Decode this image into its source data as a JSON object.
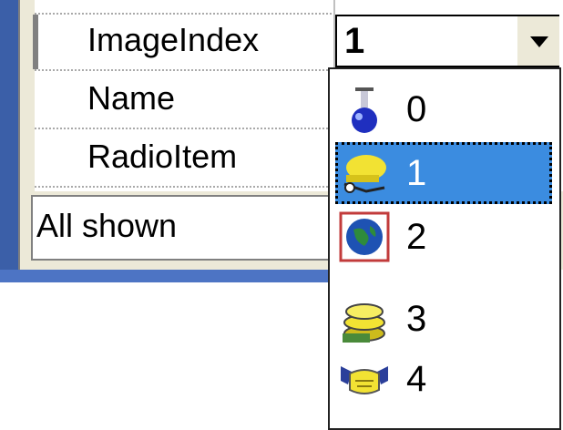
{
  "grid": {
    "rows": [
      {
        "name": "ImageIndex"
      },
      {
        "name": "Name"
      },
      {
        "name": "RadioItem"
      }
    ],
    "image_index_value": "1"
  },
  "status": {
    "label": "All shown"
  },
  "dropdown": {
    "items": [
      {
        "label": "0",
        "icon": "flask-icon",
        "selected": false
      },
      {
        "label": "1",
        "icon": "helmet-icon",
        "selected": true
      },
      {
        "label": "2",
        "icon": "globe-icon",
        "selected": false
      },
      {
        "label": "3",
        "icon": "coins-icon",
        "selected": false
      },
      {
        "label": "4",
        "icon": "handshake-icon",
        "selected": false
      }
    ]
  },
  "colors": {
    "selection": "#3b8ce0",
    "frame": "#3b5fa8",
    "panel": "#ece9d8"
  }
}
